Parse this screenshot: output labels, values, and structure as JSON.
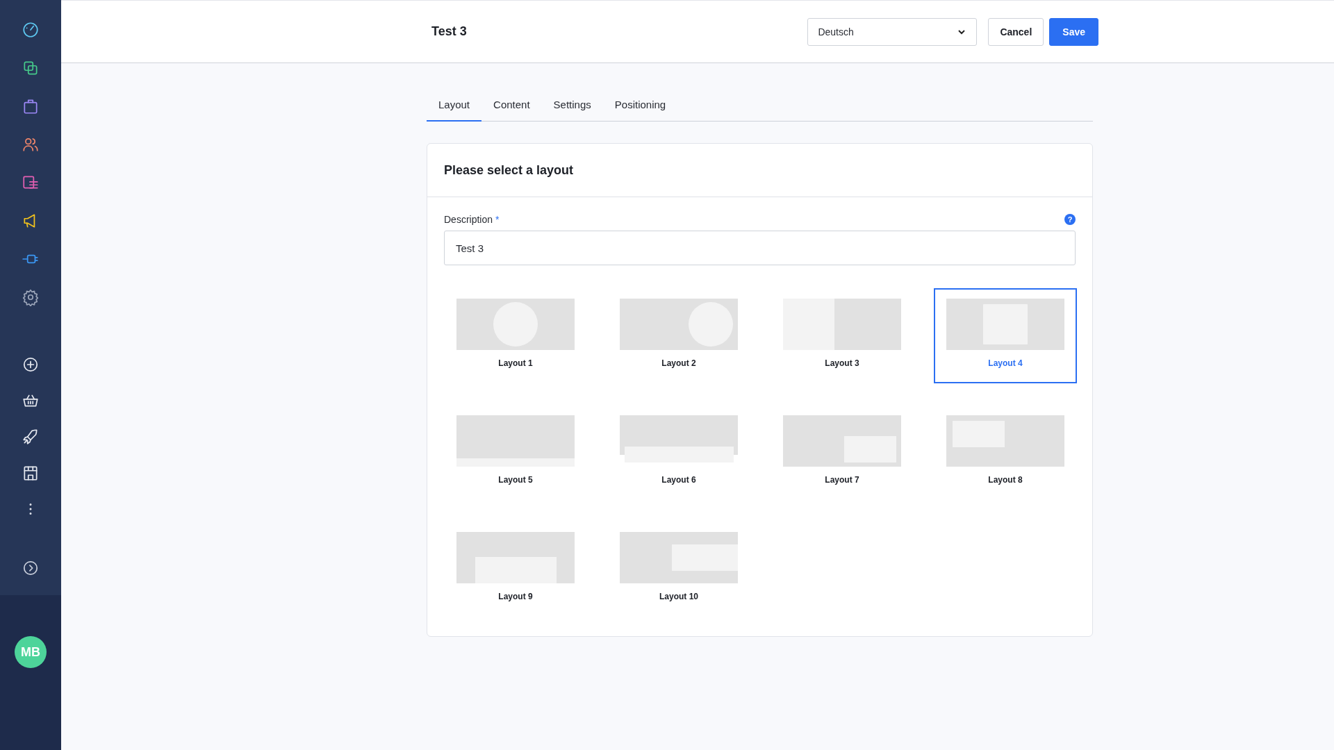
{
  "sidebar": {
    "avatar": {
      "initials": "MB"
    }
  },
  "header": {
    "title": "Test 3",
    "language_select": {
      "value": "Deutsch"
    },
    "buttons": [
      {
        "label": "Cancel",
        "kind": "secondary"
      },
      {
        "label": "Save",
        "kind": "primary"
      }
    ]
  },
  "tabs": [
    {
      "label": "Layout",
      "selected": true
    },
    {
      "label": "Content",
      "selected": false
    },
    {
      "label": "Settings",
      "selected": false
    },
    {
      "label": "Positioning",
      "selected": false
    }
  ],
  "card": {
    "title": "Please select a layout",
    "description": {
      "label": "Description",
      "required_mark": "*",
      "help_mark": "?",
      "value": "Test 3"
    },
    "layouts": [
      {
        "label": "Layout 1",
        "kind": "circle-center",
        "selected": false
      },
      {
        "label": "Layout 2",
        "kind": "circle-right",
        "selected": false
      },
      {
        "label": "Layout 3",
        "kind": "split-left",
        "selected": false
      },
      {
        "label": "Layout 4",
        "kind": "box-center",
        "selected": true
      },
      {
        "label": "Layout 5",
        "kind": "band-bottom",
        "selected": false
      },
      {
        "label": "Layout 6",
        "kind": "band-overhang",
        "selected": false
      },
      {
        "label": "Layout 7",
        "kind": "box-bottom-right",
        "selected": false
      },
      {
        "label": "Layout 8",
        "kind": "box-top-left",
        "selected": false
      },
      {
        "label": "Layout 9",
        "kind": "box-bottom-center",
        "selected": false
      },
      {
        "label": "Layout 10",
        "kind": "box-right",
        "selected": false
      }
    ]
  }
}
